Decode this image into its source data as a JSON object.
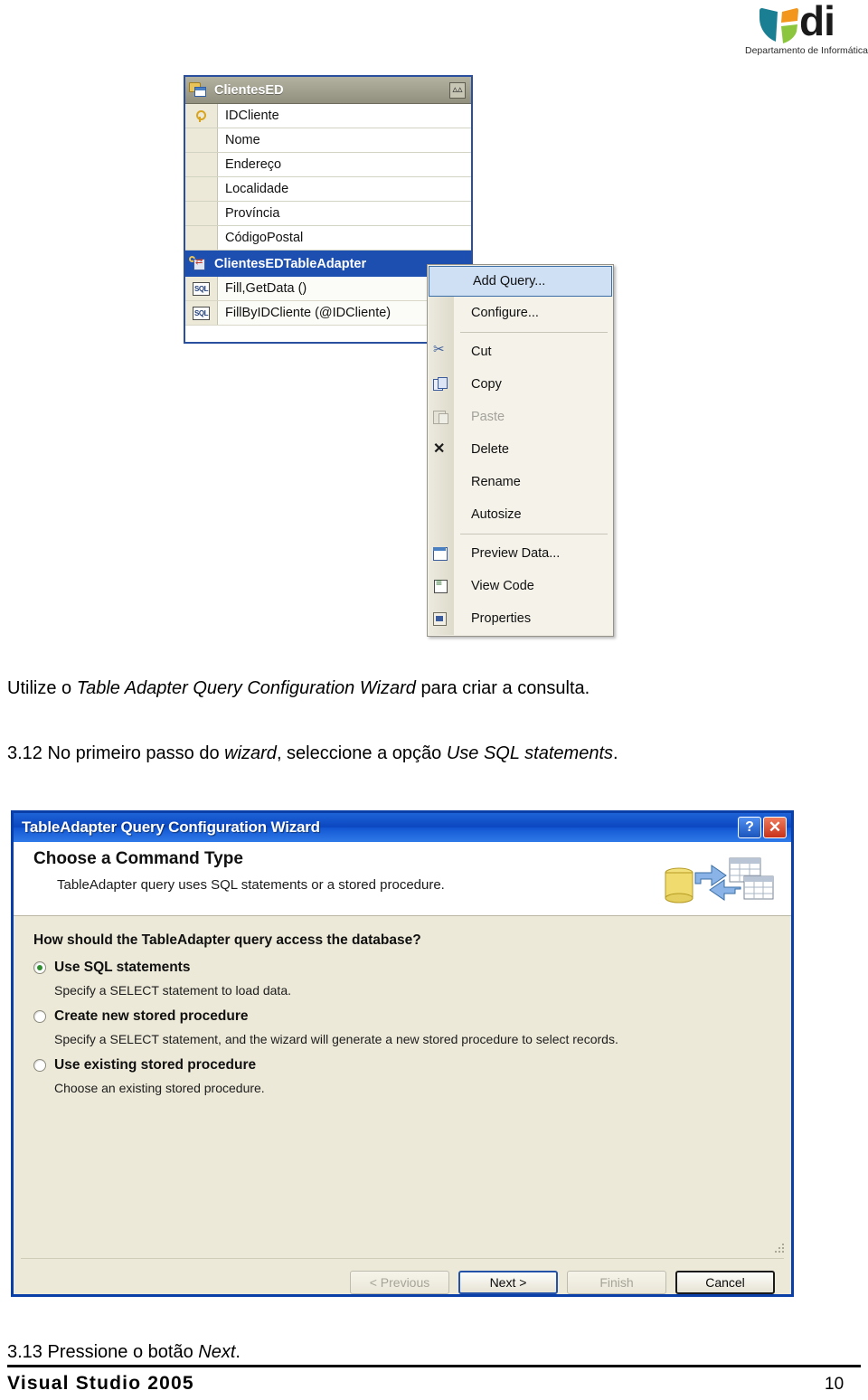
{
  "logo": {
    "wordmark": "di",
    "subtitle": "Departamento de Informática",
    "colors": {
      "teal": "#1b7f94",
      "orange": "#f3961c",
      "green": "#8cc63e",
      "text": "#1a1a1a"
    }
  },
  "dataset_designer": {
    "table": {
      "name": "ClientesED",
      "icon": "table-icon",
      "collapse_icon": "chevron-double-up-icon",
      "fields": [
        {
          "name": "IDCliente",
          "icon": "primary-key-icon"
        },
        {
          "name": "Nome",
          "icon": ""
        },
        {
          "name": "Endereço",
          "icon": ""
        },
        {
          "name": "Localidade",
          "icon": ""
        },
        {
          "name": "Província",
          "icon": ""
        },
        {
          "name": "CódigoPostal",
          "icon": ""
        }
      ]
    },
    "adapter": {
      "name": "ClientesEDTableAdapter",
      "icon": "table-adapter-icon",
      "selected": true,
      "methods": [
        {
          "name": "Fill,GetData ()",
          "icon": "sql-icon",
          "default": true
        },
        {
          "name": "FillByIDCliente (@IDCliente)",
          "icon": "sql-icon",
          "default": false
        }
      ]
    }
  },
  "context_menu": {
    "items": [
      {
        "label": "Add Query...",
        "icon": "",
        "selected": true,
        "disabled": false,
        "separator_after": false
      },
      {
        "label": "Configure...",
        "icon": "",
        "selected": false,
        "disabled": false,
        "separator_after": true
      },
      {
        "label": "Cut",
        "icon": "cut-icon",
        "selected": false,
        "disabled": false,
        "separator_after": false
      },
      {
        "label": "Copy",
        "icon": "copy-icon",
        "selected": false,
        "disabled": false,
        "separator_after": false
      },
      {
        "label": "Paste",
        "icon": "paste-icon",
        "selected": false,
        "disabled": true,
        "separator_after": false
      },
      {
        "label": "Delete",
        "icon": "delete-icon",
        "selected": false,
        "disabled": false,
        "separator_after": false
      },
      {
        "label": "Rename",
        "icon": "",
        "selected": false,
        "disabled": false,
        "separator_after": false
      },
      {
        "label": "Autosize",
        "icon": "",
        "selected": false,
        "disabled": false,
        "separator_after": true
      },
      {
        "label": "Preview Data...",
        "icon": "preview-data-icon",
        "selected": false,
        "disabled": false,
        "separator_after": false
      },
      {
        "label": "View Code",
        "icon": "view-code-icon",
        "selected": false,
        "disabled": false,
        "separator_after": false
      },
      {
        "label": "Properties",
        "icon": "properties-icon",
        "selected": false,
        "disabled": false,
        "separator_after": false
      }
    ]
  },
  "body_text": {
    "intro_prefix": "Utilize o ",
    "intro_italic": "Table Adapter Query Configuration Wizard",
    "intro_suffix": " para criar a consulta.",
    "step312_num": "3.12",
    "step312_a": " No primeiro passo do ",
    "step312_italic1": "wizard",
    "step312_b": ", seleccione a opção ",
    "step312_italic2": "Use SQL statements",
    "step312_c": ".",
    "step313_num": "3.13",
    "step313_a": " Pressione o botão ",
    "step313_italic": "Next",
    "step313_c": "."
  },
  "wizard": {
    "titlebar": {
      "title": "TableAdapter Query Configuration Wizard",
      "help_label": "?",
      "close_label": "✕"
    },
    "header": {
      "title": "Choose a Command Type",
      "subtitle": "TableAdapter query uses SQL statements or a stored procedure.",
      "art_icon": "database-to-tables-icon"
    },
    "question": "How should the TableAdapter query access the database?",
    "options": [
      {
        "label_pre": "Use ",
        "label_accel": "S",
        "label_post": "QL statements",
        "label_full": "Use SQL statements",
        "description": "Specify a SELECT statement to load data.",
        "checked": true
      },
      {
        "label_pre": "",
        "label_accel": "C",
        "label_post": "reate new stored procedure",
        "label_full": "Create new stored procedure",
        "description": "Specify a SELECT statement, and the wizard will generate a new stored procedure to select records.",
        "checked": false
      },
      {
        "label_pre": "Use ",
        "label_accel": "e",
        "label_post": "xisting stored procedure",
        "label_full": "Use existing stored procedure",
        "description": "Choose an existing stored procedure.",
        "checked": false
      }
    ],
    "buttons": [
      {
        "label": "< Previous",
        "state": "disabled",
        "accel": "P"
      },
      {
        "label": "Next >",
        "state": "default",
        "accel": "N"
      },
      {
        "label": "Finish",
        "state": "disabled",
        "accel": "F"
      },
      {
        "label": "Cancel",
        "state": "normal",
        "accel": ""
      }
    ]
  },
  "page_footer": {
    "left": "Visual Studio 2005",
    "page_number": "10"
  }
}
